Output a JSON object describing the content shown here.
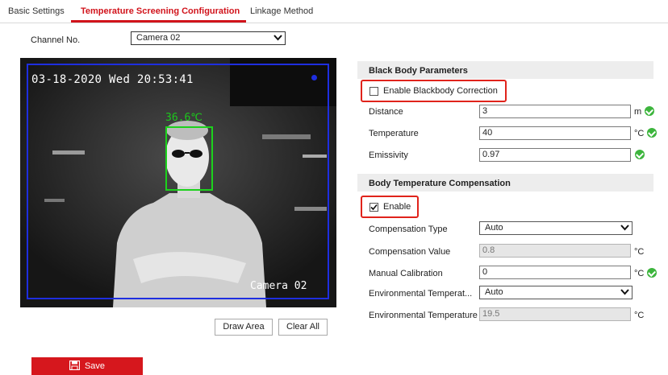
{
  "tabs": [
    {
      "label": "Basic Settings"
    },
    {
      "label": "Temperature Screening Configuration"
    },
    {
      "label": "Linkage Method"
    }
  ],
  "channel": {
    "label": "Channel No.",
    "value": "Camera 02"
  },
  "video": {
    "timestamp": "03-18-2020 Wed 20:53:41",
    "camera_label": "Camera 02",
    "face_temperature": "36.6℃"
  },
  "buttons": {
    "draw_area": "Draw Area",
    "clear_all": "Clear All",
    "save": "Save"
  },
  "blackbody": {
    "title": "Black Body Parameters",
    "enable_label": "Enable Blackbody Correction",
    "enabled": false,
    "fields": [
      {
        "label": "Distance",
        "value": "3",
        "unit": "m"
      },
      {
        "label": "Temperature",
        "value": "40",
        "unit": "°C"
      },
      {
        "label": "Emissivity",
        "value": "0.97",
        "unit": ""
      }
    ]
  },
  "compensation": {
    "title": "Body Temperature Compensation",
    "enable_label": "Enable",
    "enabled": true,
    "type_label": "Compensation Type",
    "type_value": "Auto",
    "value_label": "Compensation Value",
    "value": "0.8",
    "value_unit": "°C",
    "manual_label": "Manual Calibration",
    "manual_value": "0",
    "manual_unit": "°C",
    "env_type_label": "Environmental Temperat...",
    "env_type_value": "Auto",
    "env_temp_label": "Environmental Temperature",
    "env_temp_value": "19.5",
    "env_temp_unit": "°C"
  },
  "colors": {
    "accent": "#d1131b",
    "ok": "#3db53d",
    "roi": "#1e2ee0",
    "face_box": "#1cd21c"
  }
}
